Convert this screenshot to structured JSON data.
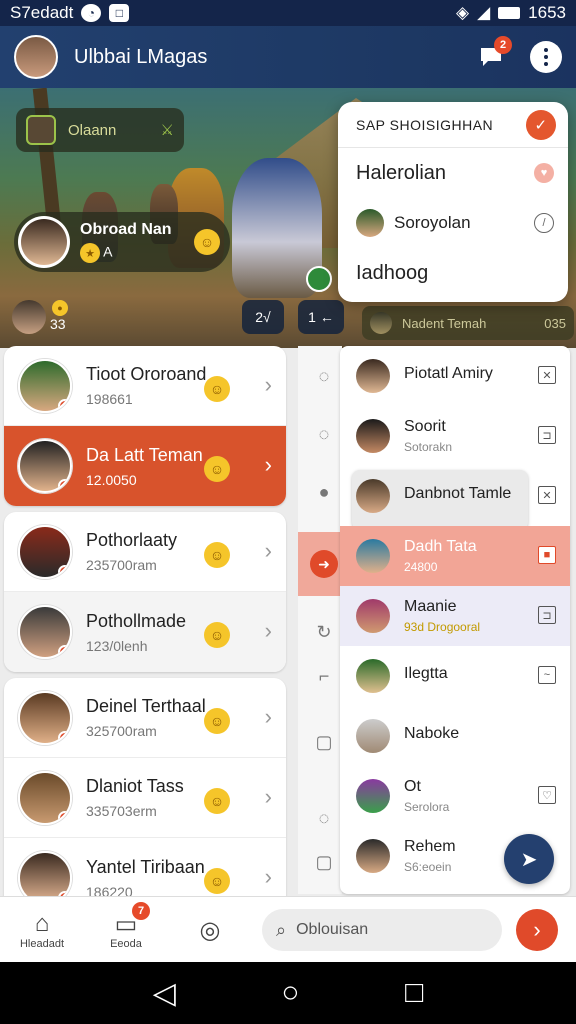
{
  "status_bar": {
    "carrier": "S7edadt",
    "clock": "1653"
  },
  "app_bar": {
    "title": "Ulbbai LMagas",
    "notification_count": "2"
  },
  "hero": {
    "chip_label": "Olaann",
    "player_name": "Obroad Nan",
    "player_sub": "A",
    "mini_number": "33",
    "control_a": "2√",
    "control_b": "1 ←",
    "pill_text": "Nadent Temah",
    "pill_value": "035"
  },
  "menu": {
    "header": "SAP SHOISIGHHAN",
    "items": [
      {
        "label": "Halerolian"
      },
      {
        "label": "Soroyolan"
      },
      {
        "label": "Iadhoog"
      }
    ]
  },
  "left_list": [
    {
      "name": "Tioot Ororoand",
      "sub": "198661",
      "state": "normal",
      "av1": "#2e6b2c",
      "av2": "#d8a880"
    },
    {
      "name": "Da Latt Teman",
      "sub": "12.0050",
      "state": "selected",
      "av1": "#222222",
      "av2": "#e2b38c"
    },
    {
      "name": "Pothorlaaty",
      "sub": "235700ram",
      "state": "normal",
      "av1": "#8a2a1a",
      "av2": "#2a2a2a"
    },
    {
      "name": "Pothollmade",
      "sub": "123/0lenh",
      "state": "alt",
      "av1": "#3a3a3a",
      "av2": "#d0a080"
    },
    {
      "name": "Deinel Terthaal",
      "sub": "325700ram",
      "state": "normal",
      "av1": "#5a3a22",
      "av2": "#e0b088"
    },
    {
      "name": "Dlaniot Tass",
      "sub": "335703erm",
      "state": "normal",
      "av1": "#6a4a2a",
      "av2": "#c89a70"
    },
    {
      "name": "Yantel Tiribaan",
      "sub": "186220",
      "state": "normal",
      "av1": "#3a2a20",
      "av2": "#e4b694"
    }
  ],
  "right_list": [
    {
      "name": "Piotatl Amiry",
      "sub": "",
      "state": "normal",
      "av1": "#3a2a20",
      "av2": "#e0b894",
      "act": "✕"
    },
    {
      "name": "Soorit",
      "sub": "Sotorakn",
      "state": "normal",
      "av1": "#1a1a1a",
      "av2": "#c48a64",
      "act": "⊐"
    },
    {
      "name": "Danbnot Tamle",
      "sub": "",
      "state": "highlight",
      "av1": "#4a3a2a",
      "av2": "#d8aa86",
      "act": "✕"
    },
    {
      "name": "Dadh Tata",
      "sub": "24800",
      "state": "red",
      "av1": "#2a7aa0",
      "av2": "#e0b08a",
      "act": "■"
    },
    {
      "name": "Maanie",
      "sub": "93d Drogooral",
      "state": "lavender",
      "av1": "#a03a6a",
      "av2": "#d09a70",
      "act": "⊐"
    },
    {
      "name": "Ilegtta",
      "sub": "",
      "state": "normal",
      "av1": "#2a6a2a",
      "av2": "#e0c090",
      "act": "~"
    },
    {
      "name": "Naboke",
      "sub": "",
      "state": "normal",
      "av1": "#cccccc",
      "av2": "#a08a74",
      "act": ""
    },
    {
      "name": "Ot",
      "sub": "Serolora",
      "state": "normal",
      "av1": "#8a3aa0",
      "av2": "#3aa04a",
      "act": "♡"
    },
    {
      "name": "Rehem",
      "sub": "S6:eoein",
      "state": "normal",
      "av1": "#2a2a2a",
      "av2": "#d8aa84",
      "act": ""
    }
  ],
  "bottom_nav": {
    "tab_home": "Hleadadt",
    "tab_chats": "Eeoda",
    "chats_badge": "7",
    "search_value": "Oblouisan"
  },
  "colors": {
    "primary": "#1d3863",
    "accent": "#e04a2a"
  }
}
